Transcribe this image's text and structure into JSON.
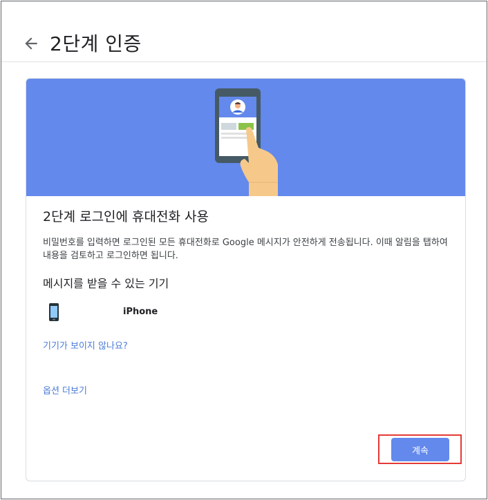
{
  "header": {
    "back_icon": "arrow-back-icon",
    "title": "2단계 인증"
  },
  "banner": {
    "illustration": "phone-tap-illustration",
    "color": "#6389ec"
  },
  "card": {
    "title": "2단계 로그인에 휴대전화 사용",
    "description": "비밀번호를 입력하면 로그인된 모든 휴대전화로 Google 메시지가 안전하게 전송됩니다. 이때 알림을 탭하여 내용을 검토하고 로그인하면 됩니다.",
    "devices_heading": "메시지를 받을 수 있는 기기",
    "devices": [
      {
        "icon": "smartphone-icon",
        "name": "iPhone"
      }
    ],
    "missing_device_link": "기기가 보이지 않나요?",
    "more_options_link": "옵션 더보기",
    "continue_label": "계속"
  },
  "colors": {
    "accent": "#6389ec",
    "link": "#4a7bd8",
    "highlight": "#e53935"
  }
}
